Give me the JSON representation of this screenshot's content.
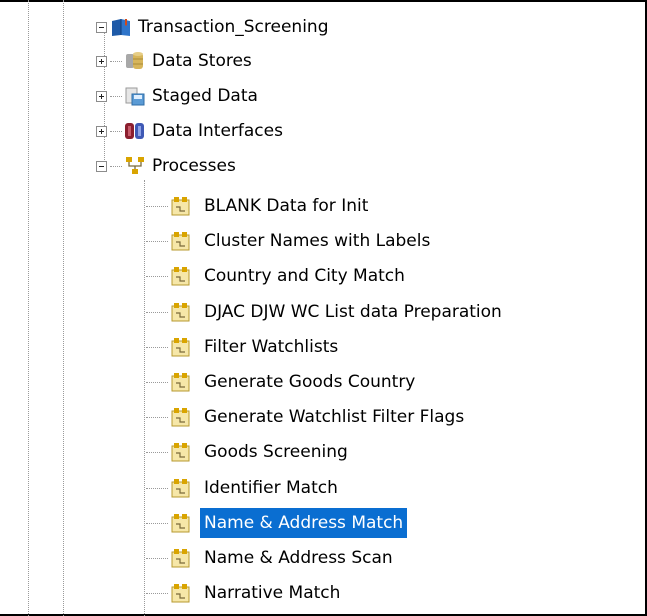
{
  "tree": {
    "root": {
      "label": "Transaction_Screening",
      "icon": "book-project-icon",
      "expanded": true
    },
    "groups": [
      {
        "label": "Data Stores",
        "icon": "data-stores-icon",
        "expanded": false
      },
      {
        "label": "Staged Data",
        "icon": "staged-data-icon",
        "expanded": false
      },
      {
        "label": "Data Interfaces",
        "icon": "data-interfaces-icon",
        "expanded": false
      },
      {
        "label": "Processes",
        "icon": "processes-icon",
        "expanded": true
      }
    ],
    "processes": [
      {
        "label": "BLANK Data for Init"
      },
      {
        "label": "Cluster Names with Labels"
      },
      {
        "label": "Country and City Match"
      },
      {
        "label": "DJAC DJW WC List data Preparation"
      },
      {
        "label": "Filter Watchlists"
      },
      {
        "label": "Generate Goods Country"
      },
      {
        "label": "Generate Watchlist Filter Flags"
      },
      {
        "label": "Goods Screening"
      },
      {
        "label": "Identifier Match"
      },
      {
        "label": "Name & Address Match",
        "selected": true
      },
      {
        "label": "Name & Address Scan"
      },
      {
        "label": "Narrative Match"
      }
    ],
    "colors": {
      "selection": "#0a6ed1",
      "tree_lines": "#9a9a9a"
    }
  }
}
